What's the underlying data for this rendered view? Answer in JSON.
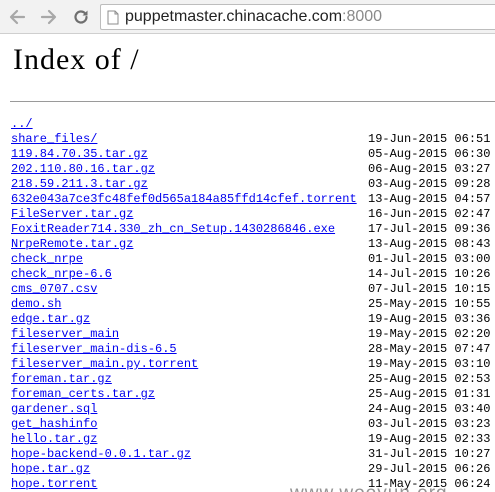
{
  "browser": {
    "url_host": "puppetmaster.chinacache.com",
    "url_port": ":8000",
    "icons": {
      "back": "back-arrow-icon",
      "forward": "forward-arrow-icon",
      "reload": "reload-icon",
      "page": "page-icon"
    }
  },
  "page": {
    "title": "Index of /",
    "parent_link": "../",
    "entries": [
      {
        "name": "share_files/",
        "date": "19-Jun-2015 06:51"
      },
      {
        "name": "119.84.70.35.tar.gz",
        "date": "05-Aug-2015 06:30"
      },
      {
        "name": "202.110.80.16.tar.gz",
        "date": "06-Aug-2015 03:27"
      },
      {
        "name": "218.59.211.3.tar.gz",
        "date": "03-Aug-2015 09:28"
      },
      {
        "name": "632e043a7ce3fc48fef0d565a184a85ffd14cfef.torrent",
        "date": "13-Aug-2015 04:57"
      },
      {
        "name": "FileServer.tar.gz",
        "date": "16-Jun-2015 02:47"
      },
      {
        "name": "FoxitReader714.330_zh_cn_Setup.1430286846.exe",
        "date": "17-Jul-2015 09:36"
      },
      {
        "name": "NrpeRemote.tar.gz",
        "date": "13-Aug-2015 08:43"
      },
      {
        "name": "check_nrpe",
        "date": "01-Jul-2015 03:00"
      },
      {
        "name": "check_nrpe-6.6",
        "date": "14-Jul-2015 10:26"
      },
      {
        "name": "cms_0707.csv",
        "date": "07-Jul-2015 10:15"
      },
      {
        "name": "demo.sh",
        "date": "25-May-2015 10:55"
      },
      {
        "name": "edge.tar.gz",
        "date": "19-Aug-2015 03:36"
      },
      {
        "name": "fileserver_main",
        "date": "19-May-2015 02:20"
      },
      {
        "name": "fileserver_main-dis-6.5",
        "date": "28-May-2015 07:47"
      },
      {
        "name": "fileserver_main.py.torrent",
        "date": "19-May-2015 03:10"
      },
      {
        "name": "foreman.tar.gz",
        "date": "25-Aug-2015 02:53"
      },
      {
        "name": "foreman_certs.tar.gz",
        "date": "25-Aug-2015 01:31"
      },
      {
        "name": "gardener.sql",
        "date": "24-Aug-2015 03:40"
      },
      {
        "name": "get_hashinfo",
        "date": "03-Jul-2015 03:23"
      },
      {
        "name": "hello.tar.gz",
        "date": "19-Aug-2015 02:33"
      },
      {
        "name": "hope-backend-0.0.1.tar.gz",
        "date": "31-Jul-2015 10:27"
      },
      {
        "name": "hope.tar.gz",
        "date": "29-Jul-2015 06:26"
      },
      {
        "name": "hope.torrent",
        "date": "11-May-2015 06:24"
      }
    ]
  },
  "watermark": {
    "text": "www.wooyun.org"
  }
}
